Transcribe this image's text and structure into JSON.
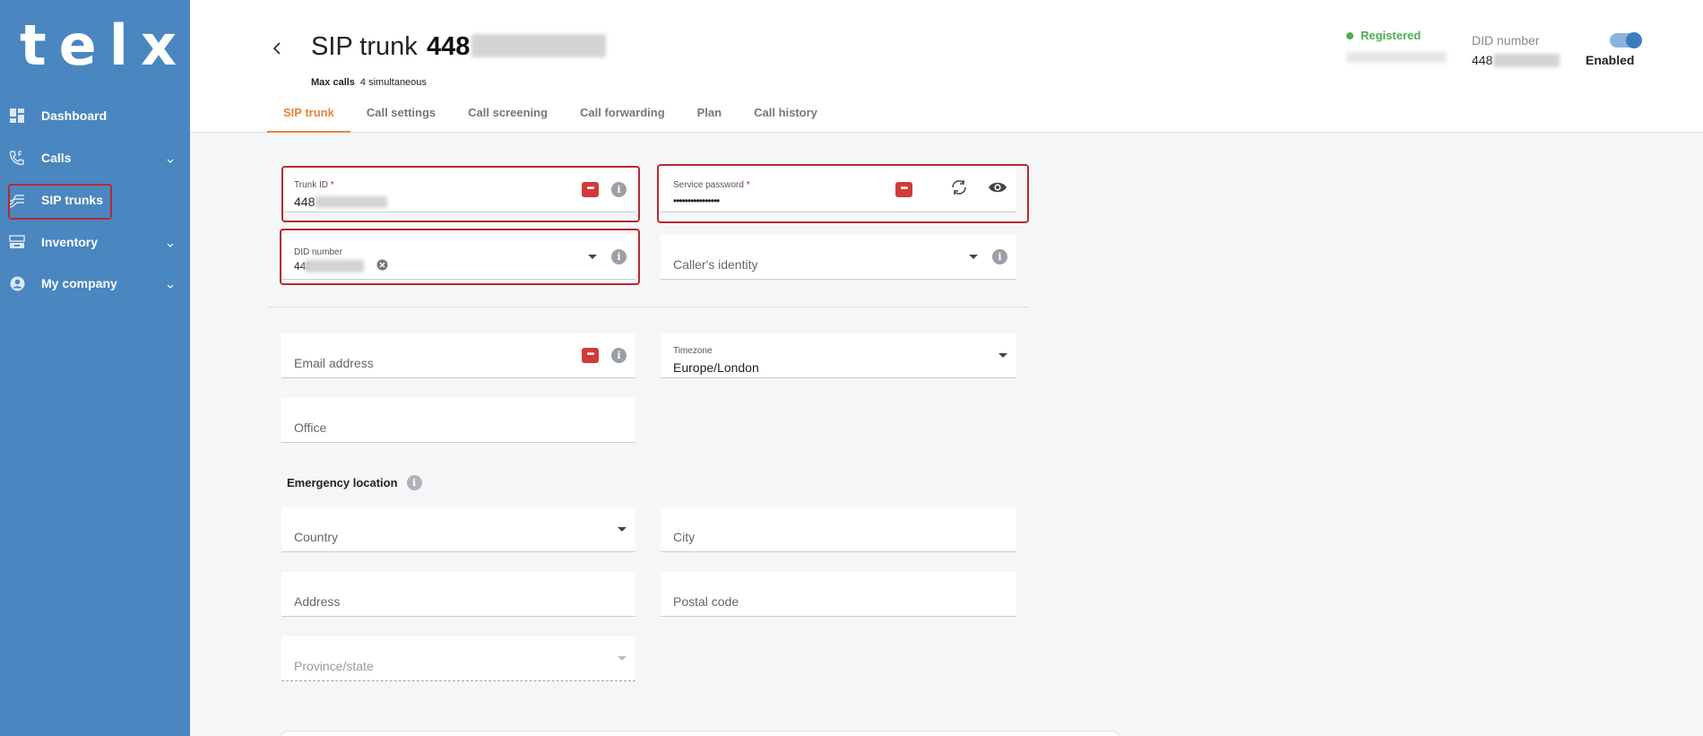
{
  "brand": {
    "logo_text": "telxi"
  },
  "sidebar": {
    "items": [
      {
        "label": "Dashboard",
        "icon": "dashboard-icon",
        "has_chevron": false
      },
      {
        "label": "Calls",
        "icon": "phone-icon",
        "has_chevron": true
      },
      {
        "label": "SIP trunks",
        "icon": "sip-trunk-icon",
        "has_chevron": false,
        "active": true
      },
      {
        "label": "Inventory",
        "icon": "inventory-icon",
        "has_chevron": true
      },
      {
        "label": "My company",
        "icon": "account-circle-icon",
        "has_chevron": true
      }
    ]
  },
  "header": {
    "back_icon": "chevron-left-icon",
    "title": "SIP trunk",
    "title_number_visible": "448",
    "max_calls_label": "Max calls",
    "max_calls_value": "4 simultaneous",
    "status": "Registered",
    "did_label": "DID number",
    "did_value_visible": "448",
    "toggle_label": "Enabled"
  },
  "tabs": [
    {
      "label": "SIP trunk",
      "active": true
    },
    {
      "label": "Call settings"
    },
    {
      "label": "Call screening"
    },
    {
      "label": "Call forwarding"
    },
    {
      "label": "Plan"
    },
    {
      "label": "Call history"
    }
  ],
  "form": {
    "trunk_id": {
      "label": "Trunk ID",
      "required_mark": "*",
      "value_visible": "448"
    },
    "service_password": {
      "label": "Service password",
      "required_mark": "*",
      "value": "••••••••••••••••"
    },
    "did_number": {
      "label": "DID number",
      "value_visible": "448"
    },
    "callers_identity": {
      "placeholder": "Caller's identity"
    },
    "email": {
      "placeholder": "Email address"
    },
    "timezone": {
      "label": "Timezone",
      "value": "Europe/London"
    },
    "office": {
      "placeholder": "Office"
    },
    "emergency_title": "Emergency location",
    "country": {
      "placeholder": "Country"
    },
    "city": {
      "placeholder": "City"
    },
    "address": {
      "placeholder": "Address"
    },
    "postal_code": {
      "placeholder": "Postal code"
    },
    "province": {
      "placeholder": "Province/state"
    }
  },
  "icons": {
    "password_manager": "password-manager-icon",
    "info": "info-icon",
    "regenerate": "regenerate-icon",
    "visibility": "eye-icon",
    "clear": "clear-icon",
    "dropdown": "caret-down-icon"
  },
  "colors": {
    "sidebar_bg": "#4a86c0",
    "accent": "#e8833a",
    "status_green": "#4caf50",
    "highlight_red": "#b52a30"
  }
}
